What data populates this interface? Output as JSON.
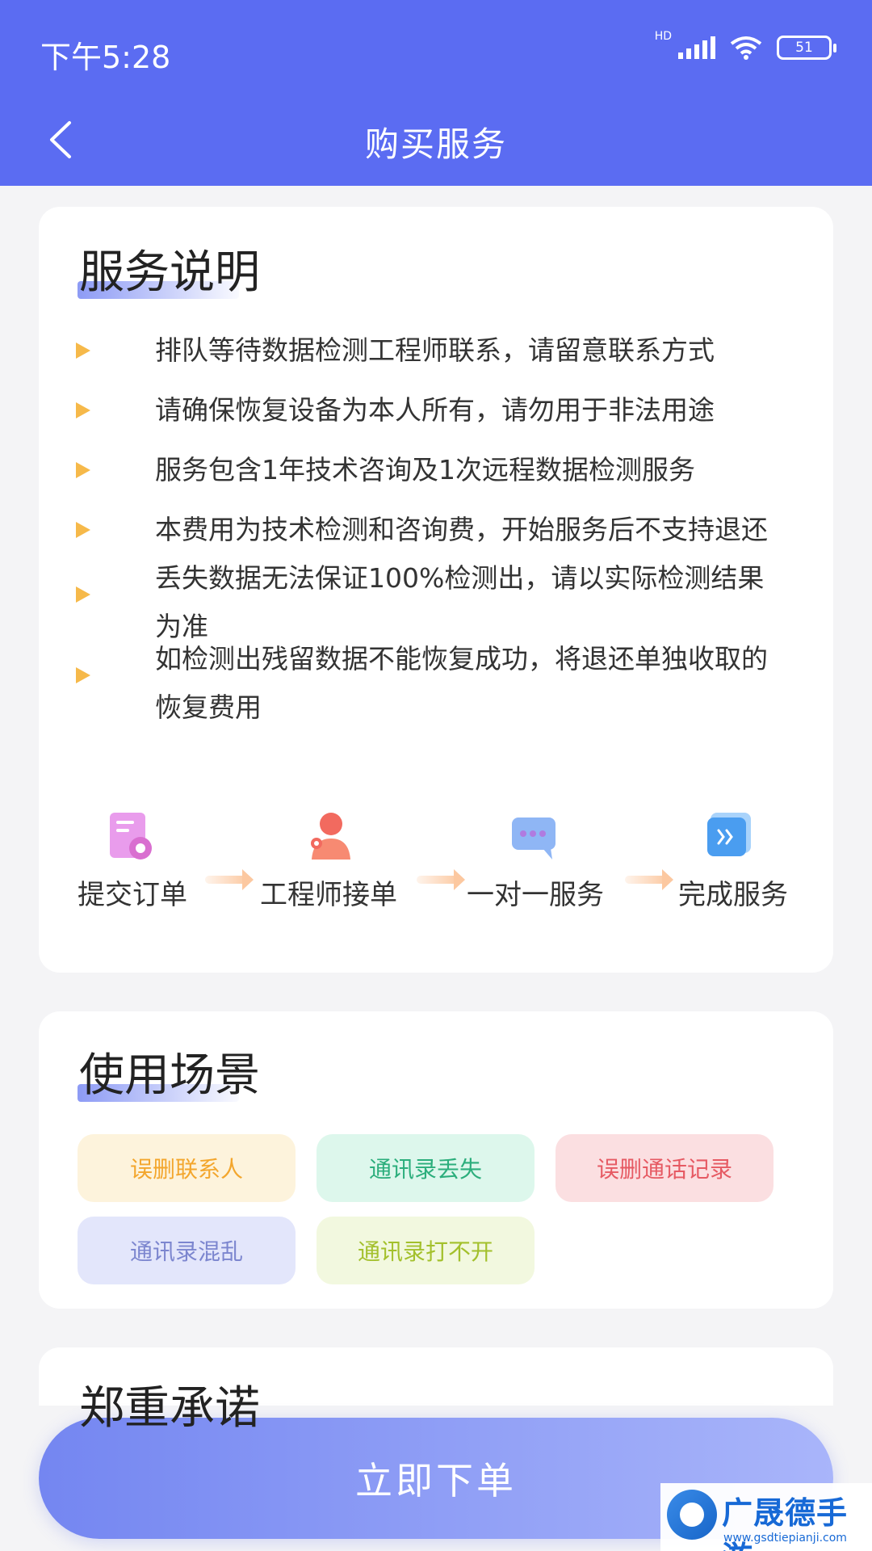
{
  "status_bar": {
    "time": "下午5:28",
    "network_label": "HD",
    "battery_level": "51"
  },
  "nav": {
    "back_icon": "chevron-left-icon",
    "title": "购买服务"
  },
  "service_info": {
    "title": "服务说明",
    "bullets": [
      {
        "lines": [
          "排队等待数据检测工程师联系，请留意联系方式"
        ]
      },
      {
        "lines": [
          "请确保恢复设备为本人所有，请勿用于非法用途"
        ]
      },
      {
        "lines": [
          "服务包含1年技术咨询及1次远程数据检测服务"
        ]
      },
      {
        "lines": [
          "本费用为技术检测和咨询费，开始服务后不支持退还"
        ]
      },
      {
        "lines": [
          "丢失数据无法保证100%检测出，请以实际检测结果",
          "为准"
        ]
      },
      {
        "lines": [
          "如检测出残留数据不能恢复成功，将退还单独收取的",
          "恢复费用"
        ]
      }
    ],
    "steps": [
      {
        "label": "提交订单",
        "icon": "order-document-icon"
      },
      {
        "label": "工程师接单",
        "icon": "engineer-avatar-icon"
      },
      {
        "label": "一对一服务",
        "icon": "chat-bubble-icon"
      },
      {
        "label": "完成服务",
        "icon": "double-chevron-icon"
      }
    ],
    "arrow_icon": "arrow-right-icon"
  },
  "scenarios": {
    "title": "使用场景",
    "tags": [
      {
        "label": "误删联系人",
        "bg": "#fdf3dc",
        "fg": "#f3a62d"
      },
      {
        "label": "通讯录丢失",
        "bg": "#ddf7ec",
        "fg": "#2cae7c"
      },
      {
        "label": "误删通话记录",
        "bg": "#fbdfe1",
        "fg": "#e65a63"
      },
      {
        "label": "通讯录混乱",
        "bg": "#e3e6fb",
        "fg": "#7c86cf"
      },
      {
        "label": "通讯录打不开",
        "bg": "#f2f8df",
        "fg": "#a3c02c"
      }
    ]
  },
  "promise": {
    "title": "郑重承诺"
  },
  "order_button": {
    "label": "立即下单"
  },
  "watermark": {
    "name": "广晟德手游",
    "url": "www.gsdtiepianji.com"
  },
  "colors": {
    "header": "#5b6cf2",
    "bullet": "#f6b94a",
    "button_start": "#7486f1",
    "button_end": "#a9b5fa"
  }
}
